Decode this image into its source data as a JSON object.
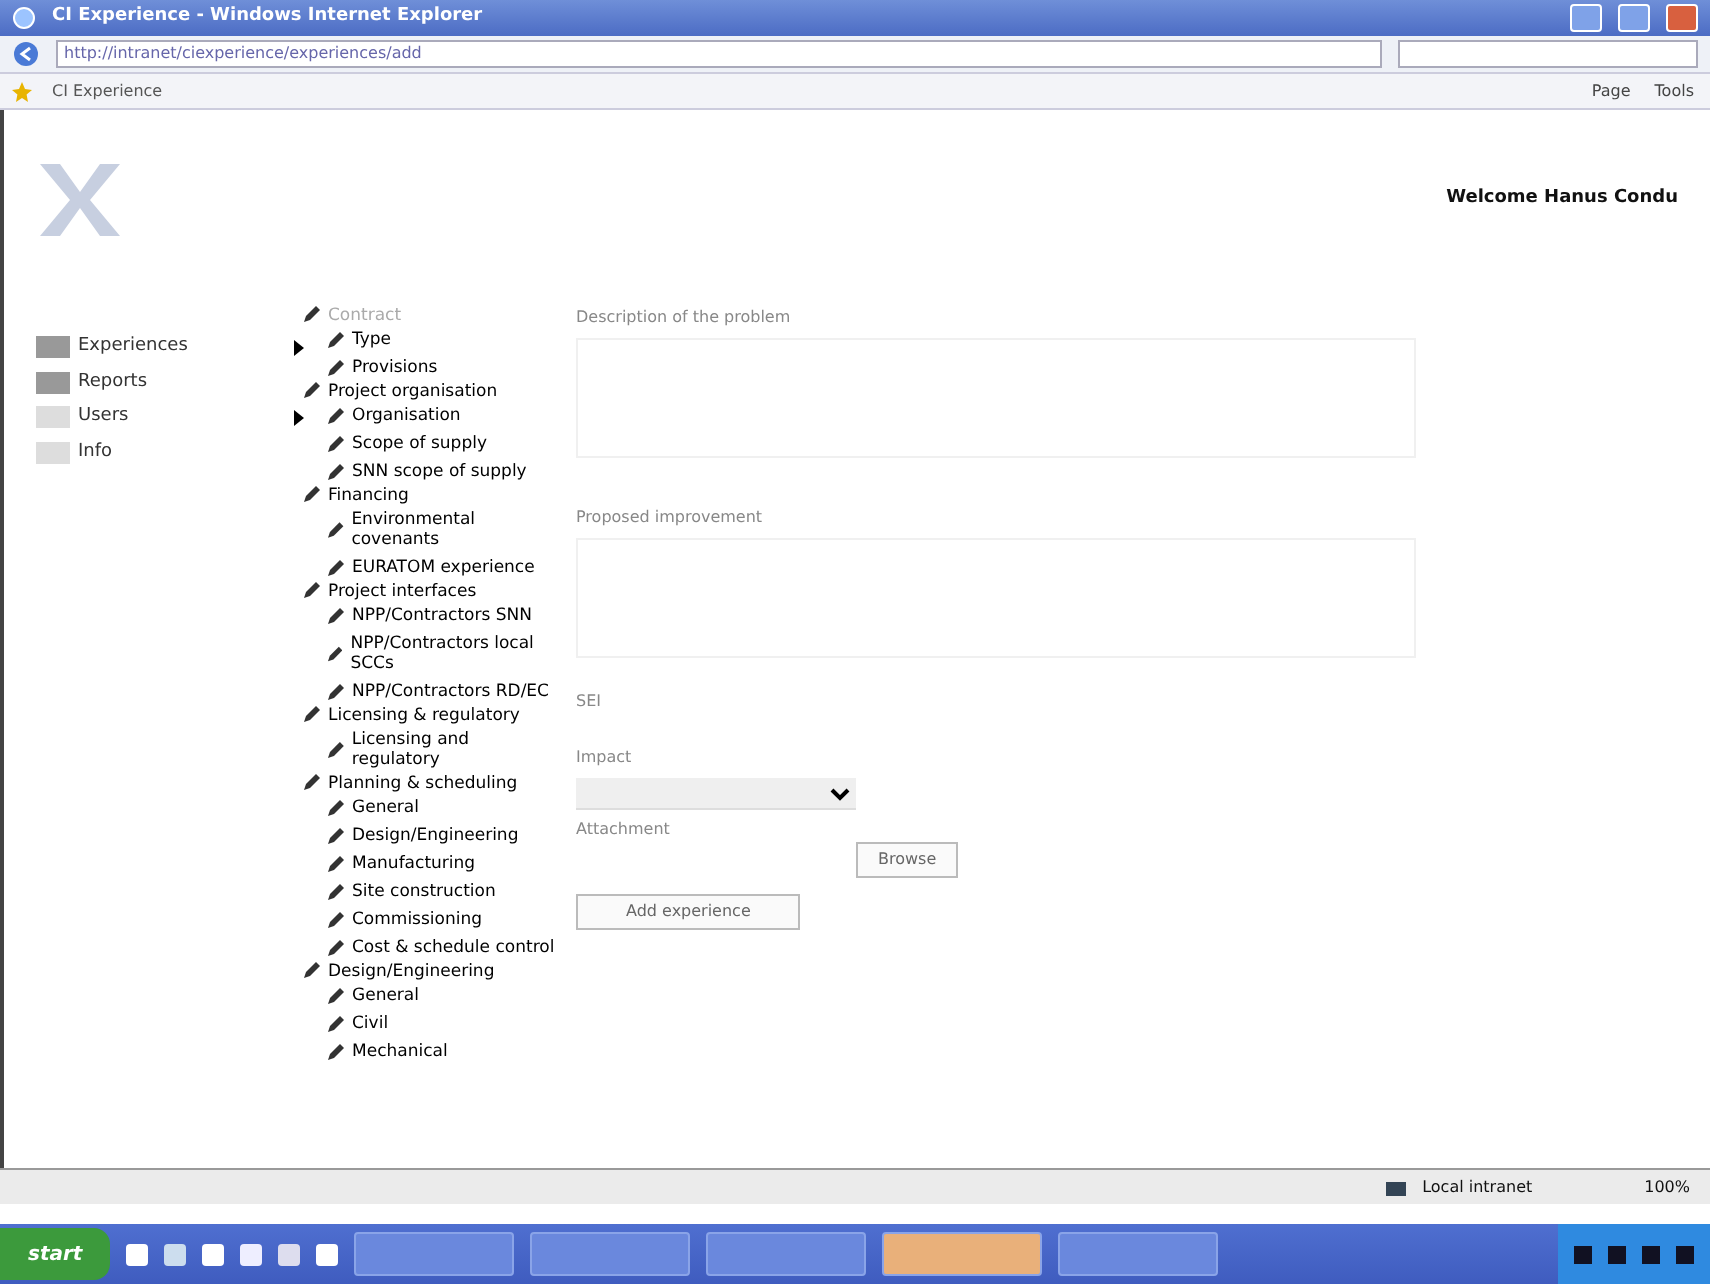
{
  "window": {
    "title": "CI Experience - Windows Internet Explorer"
  },
  "address_bar": {
    "url": "http://intranet/ciexperience/experiences/add"
  },
  "tab": {
    "label": "CI Experience"
  },
  "command_bar": [
    "Page",
    "Tools"
  ],
  "header": {
    "welcome": "Welcome Hanus Condu"
  },
  "menu": [
    {
      "label": "Experiences",
      "has_submenu": true
    },
    {
      "label": "Reports",
      "has_submenu": false
    },
    {
      "label": "Users",
      "has_submenu": true
    },
    {
      "label": "Info",
      "has_submenu": false
    }
  ],
  "tree": [
    {
      "label": "Contract",
      "disabled": true,
      "children": [
        {
          "label": "Type"
        },
        {
          "label": "Provisions"
        }
      ]
    },
    {
      "label": "Project organisation",
      "disabled": false,
      "children": [
        {
          "label": "Organisation"
        },
        {
          "label": "Scope of supply"
        },
        {
          "label": "SNN scope of supply"
        }
      ]
    },
    {
      "label": "Financing",
      "disabled": false,
      "children": [
        {
          "label": "Environmental covenants"
        },
        {
          "label": "EURATOM experience"
        }
      ]
    },
    {
      "label": "Project interfaces",
      "disabled": false,
      "children": [
        {
          "label": "NPP/Contractors SNN"
        },
        {
          "label": "NPP/Contractors local SCCs"
        },
        {
          "label": "NPP/Contractors RD/EC"
        }
      ]
    },
    {
      "label": "Licensing & regulatory",
      "disabled": false,
      "children": [
        {
          "label": "Licensing and regulatory"
        }
      ]
    },
    {
      "label": "Planning & scheduling",
      "disabled": false,
      "children": [
        {
          "label": "General"
        },
        {
          "label": "Design/Engineering"
        },
        {
          "label": "Manufacturing"
        },
        {
          "label": "Site construction"
        },
        {
          "label": "Commissioning"
        },
        {
          "label": "Cost & schedule control"
        }
      ]
    },
    {
      "label": "Design/Engineering",
      "disabled": false,
      "children": [
        {
          "label": "General"
        },
        {
          "label": "Civil"
        },
        {
          "label": "Mechanical"
        }
      ]
    }
  ],
  "form": {
    "description_label": "Description of the problem",
    "improvement_label": "Proposed improvement",
    "sei_label": "SEI",
    "impact_label": "Impact",
    "attachment_label": "Attachment",
    "browse_button": "Browse",
    "submit_button": "Add experience"
  },
  "status_bar": {
    "zone": "Local intranet",
    "zoom": "100%"
  },
  "taskbar": {
    "start": "start"
  }
}
